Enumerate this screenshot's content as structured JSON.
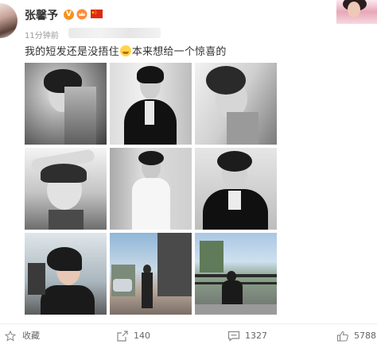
{
  "post": {
    "author_name": "张馨予",
    "verified_badge": "V",
    "time": "11分钟前",
    "text": [
      "我的短发还是没捂住",
      "本来想给一个惊喜的"
    ]
  },
  "photos": [
    {
      "name": "photo-1",
      "style": "bw"
    },
    {
      "name": "photo-2",
      "style": "bw"
    },
    {
      "name": "photo-3",
      "style": "bw"
    },
    {
      "name": "photo-4",
      "style": "bw"
    },
    {
      "name": "photo-5",
      "style": "bw"
    },
    {
      "name": "photo-6",
      "style": "bw"
    },
    {
      "name": "photo-7",
      "style": "color"
    },
    {
      "name": "photo-8",
      "style": "color"
    },
    {
      "name": "photo-9",
      "style": "color"
    }
  ],
  "actions": {
    "favorite_label": "收藏",
    "repost_count": "140",
    "comment_count": "1327",
    "like_count": "5788"
  },
  "colors": {
    "verified": "#f7931e",
    "flag": "#de2910",
    "text": "#333333",
    "muted": "#999999"
  }
}
